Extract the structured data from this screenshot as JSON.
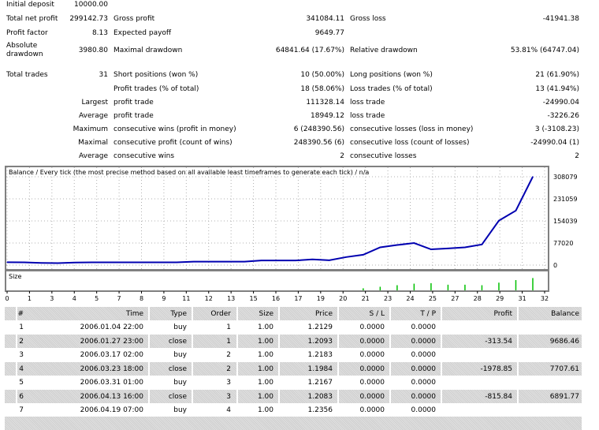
{
  "stats": {
    "initial_deposit": {
      "label": "Initial deposit",
      "value": "10000.00"
    },
    "row1": [
      {
        "label": "Total net profit",
        "value": "299142.73"
      },
      {
        "label": "Gross profit",
        "value": "341084.11"
      },
      {
        "label": "Gross loss",
        "value": "-41941.38"
      }
    ],
    "row2": [
      {
        "label": "Profit factor",
        "value": "8.13"
      },
      {
        "label": "Expected payoff",
        "value": "9649.77"
      }
    ],
    "row3": [
      {
        "label": "Absolute drawdown",
        "value": "3980.80"
      },
      {
        "label": "Maximal drawdown",
        "value": "64841.64 (17.67%)"
      },
      {
        "label": "Relative drawdown",
        "value": "53.81% (64747.04)"
      }
    ],
    "row4": [
      {
        "label": "Total trades",
        "value": "31"
      },
      {
        "label": "Short positions (won %)",
        "value": "10 (50.00%)"
      },
      {
        "label": "Long positions (won %)",
        "value": "21 (61.90%)"
      }
    ],
    "row5": [
      {
        "label": "Profit trades (% of total)",
        "value": "18 (58.06%)"
      },
      {
        "label": "Loss trades (% of total)",
        "value": "13 (41.94%)"
      }
    ],
    "row6": {
      "prefix": "Largest",
      "items": [
        {
          "label": "profit trade",
          "value": "111328.14"
        },
        {
          "label": "loss trade",
          "value": "-24990.04"
        }
      ]
    },
    "row7": {
      "prefix": "Average",
      "items": [
        {
          "label": "profit trade",
          "value": "18949.12"
        },
        {
          "label": "loss trade",
          "value": "-3226.26"
        }
      ]
    },
    "row8": {
      "prefix": "Maximum",
      "items": [
        {
          "label": "consecutive wins (profit in money)",
          "value": "6 (248390.56)"
        },
        {
          "label": "consecutive losses (loss in money)",
          "value": "3 (-3108.23)"
        }
      ]
    },
    "row9": {
      "prefix": "Maximal",
      "items": [
        {
          "label": "consecutive profit (count of wins)",
          "value": "248390.56 (6)"
        },
        {
          "label": "consecutive loss (count of losses)",
          "value": "-24990.04 (1)"
        }
      ]
    },
    "row10": {
      "prefix": "Average",
      "items": [
        {
          "label": "consecutive wins",
          "value": "2"
        },
        {
          "label": "consecutive losses",
          "value": "2"
        }
      ]
    }
  },
  "chart_data": {
    "type": "line",
    "title": "Balance / Every tick (the most precise method based on all available least timeframes to generate each tick) / n/a",
    "size_label": "Size",
    "x_ticks": [
      "0",
      "1",
      "3",
      "4",
      "5",
      "7",
      "8",
      "9",
      "11",
      "12",
      "13",
      "15",
      "16",
      "17",
      "19",
      "20",
      "21",
      "23",
      "24",
      "25",
      "27",
      "28",
      "29",
      "31",
      "32"
    ],
    "y_ticks": [
      "308079",
      "231059",
      "154039",
      "77020",
      "0"
    ],
    "ylim": [
      0,
      308079
    ],
    "xlim": [
      0,
      32
    ],
    "grid": true,
    "line_color": "#0000b0",
    "size_color": "#00c000",
    "balance": [
      [
        0,
        10000
      ],
      [
        1,
        9686
      ],
      [
        2,
        7708
      ],
      [
        3,
        6892
      ],
      [
        4,
        9000
      ],
      [
        5,
        9500
      ],
      [
        6,
        9500
      ],
      [
        7,
        9500
      ],
      [
        8,
        9500
      ],
      [
        9,
        9600
      ],
      [
        10,
        9600
      ],
      [
        11,
        12000
      ],
      [
        12,
        12000
      ],
      [
        13,
        12000
      ],
      [
        14,
        12000
      ],
      [
        15,
        16000
      ],
      [
        16,
        16000
      ],
      [
        17,
        16000
      ],
      [
        18,
        20000
      ],
      [
        19,
        17000
      ],
      [
        20,
        28000
      ],
      [
        21,
        36000
      ],
      [
        22,
        62000
      ],
      [
        23,
        70000
      ],
      [
        24,
        77000
      ],
      [
        25,
        55000
      ],
      [
        26,
        58000
      ],
      [
        27,
        62000
      ],
      [
        28,
        72000
      ],
      [
        29,
        155000
      ],
      [
        30,
        190000
      ],
      [
        31,
        308079
      ]
    ],
    "size": [
      [
        21,
        0.2
      ],
      [
        22,
        0.35
      ],
      [
        23,
        0.5
      ],
      [
        24,
        0.65
      ],
      [
        25,
        0.7
      ],
      [
        26,
        0.55
      ],
      [
        27,
        0.55
      ],
      [
        28,
        0.5
      ],
      [
        29,
        0.75
      ],
      [
        30,
        1.0
      ],
      [
        31,
        1.2
      ]
    ]
  },
  "table": {
    "headers": [
      "#",
      "Time",
      "Type",
      "Order",
      "Size",
      "Price",
      "S / L",
      "T / P",
      "Profit",
      "Balance"
    ],
    "rows": [
      [
        "1",
        "2006.01.04 22:00",
        "buy",
        "1",
        "1.00",
        "1.2129",
        "0.0000",
        "0.0000",
        "",
        ""
      ],
      [
        "2",
        "2006.01.27 23:00",
        "close",
        "1",
        "1.00",
        "1.2093",
        "0.0000",
        "0.0000",
        "-313.54",
        "9686.46"
      ],
      [
        "3",
        "2006.03.17 02:00",
        "buy",
        "2",
        "1.00",
        "1.2183",
        "0.0000",
        "0.0000",
        "",
        ""
      ],
      [
        "4",
        "2006.03.23 18:00",
        "close",
        "2",
        "1.00",
        "1.1984",
        "0.0000",
        "0.0000",
        "-1978.85",
        "7707.61"
      ],
      [
        "5",
        "2006.03.31 01:00",
        "buy",
        "3",
        "1.00",
        "1.2167",
        "0.0000",
        "0.0000",
        "",
        ""
      ],
      [
        "6",
        "2006.04.13 16:00",
        "close",
        "3",
        "1.00",
        "1.2083",
        "0.0000",
        "0.0000",
        "-815.84",
        "6891.77"
      ],
      [
        "7",
        "2006.04.19 07:00",
        "buy",
        "4",
        "1.00",
        "1.2356",
        "0.0000",
        "0.0000",
        "",
        ""
      ]
    ]
  }
}
